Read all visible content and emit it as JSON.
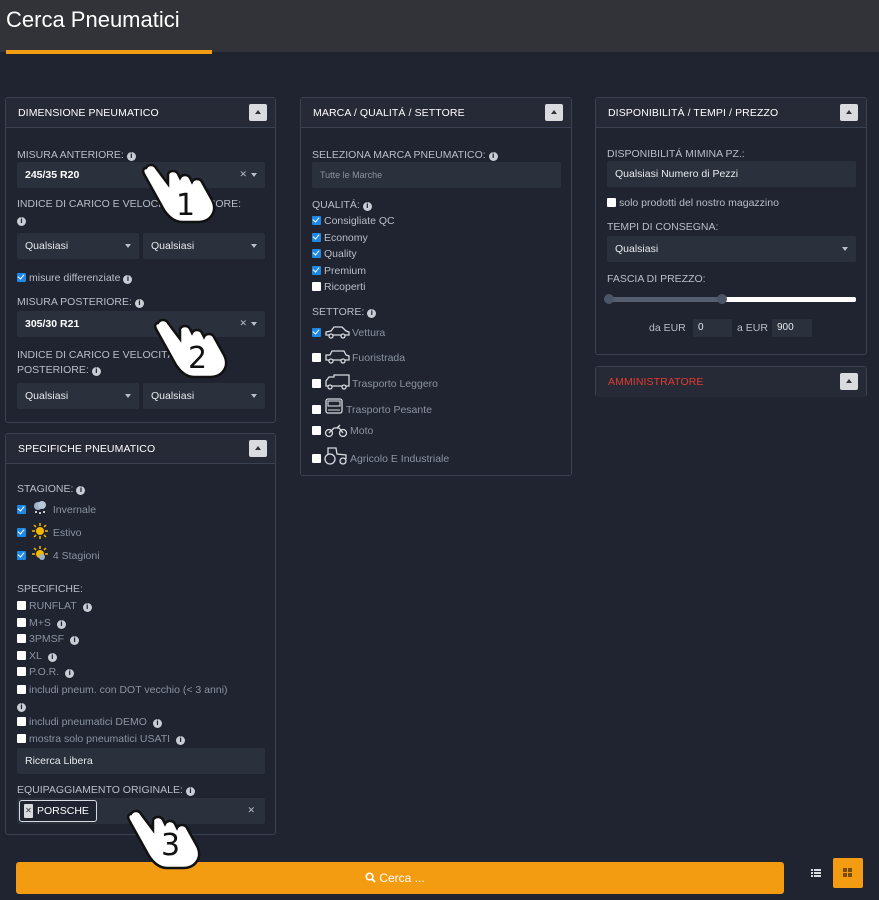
{
  "header": {
    "title": "Cerca Pneumatici"
  },
  "dimensione": {
    "title": "DIMENSIONE PNEUMATICO",
    "misura_anteriore_label": "MISURA ANTERIORE:",
    "misura_anteriore_value": "245/35 R20",
    "indice_anteriore_label": "INDICE DI CARICO E VELOCITÁ ANTERIORE:",
    "carico_anteriore": "Qualsiasi",
    "velocita_anteriore": "Qualsiasi",
    "misure_diff_label": "misure differenziate",
    "misura_posteriore_label": "MISURA POSTERIORE:",
    "misura_posteriore_value": "305/30 R21",
    "indice_posteriore_label_1": "INDICE DI CARICO E VELOCITÁ",
    "indice_posteriore_label_2": "POSTERIORE:",
    "carico_posteriore": "Qualsiasi",
    "velocita_posteriore": "Qualsiasi"
  },
  "specifiche": {
    "title": "SPECIFICHE PNEUMATICO",
    "stagione_label": "STAGIONE:",
    "stagioni": [
      "Invernale",
      "Estivo",
      "4 Stagioni"
    ],
    "specifiche_label": "SPECIFICHE:",
    "options": [
      "RUNFLAT",
      "M+S",
      "3PMSF",
      "XL",
      "P.O.R."
    ],
    "dot_label": "includi pneum. con DOT vecchio (< 3 anni)",
    "demo_label": "includi pneumatici DEMO",
    "usati_label": "mostra solo pneumatici USATI",
    "ricerca_libera": "Ricerca Libera",
    "equip_label": "EQUIPAGGIAMENTO ORIGINALE:",
    "equip_tag": "PORSCHE"
  },
  "marca": {
    "title": "MARCA / QUALITÁ / SETTORE",
    "marca_label": "SELEZIONA MARCA PNEUMATICO:",
    "marca_placeholder": "Tutte le Marche",
    "qualita_label": "QUALITÁ:",
    "qualita": [
      "Consigliate QC",
      "Economy",
      "Quality",
      "Premium",
      "Ricoperti"
    ],
    "settore_label": "SETTORE:",
    "settori": [
      "Vettura",
      "Fuoristrada",
      "Trasporto Leggero",
      "Trasporto Pesante",
      "Moto",
      "Agricolo E Industriale"
    ]
  },
  "disponibilita": {
    "title": "DISPONIBILITÁ / TEMPI / PREZZO",
    "min_label": "DISPONIBILITÁ MIMINA PZ.:",
    "min_value": "Qualsiasi Numero di Pezzi",
    "magazzino_label": "solo prodotti del nostro magazzino",
    "tempi_label": "TEMPI DI CONSEGNA:",
    "tempi_value": "Qualsiasi",
    "fascia_label": "FASCIA DI PREZZO:",
    "da_label": "da EUR",
    "da_value": "0",
    "a_label": "a EUR",
    "a_value": "900",
    "price_range": {
      "min": 0,
      "max": 900,
      "selected_from_fraction": 0.0,
      "selected_to_fraction": 0.46
    }
  },
  "amministratore": {
    "title": "AMMINISTRATORE"
  },
  "actions": {
    "search_label": "Cerca ..."
  },
  "gestures": [
    "1",
    "2",
    "3"
  ],
  "colors": {
    "accent": "#f39c12",
    "checkbox": "#1e88e5",
    "admin": "#e23b2e",
    "background": "#1f2430"
  }
}
